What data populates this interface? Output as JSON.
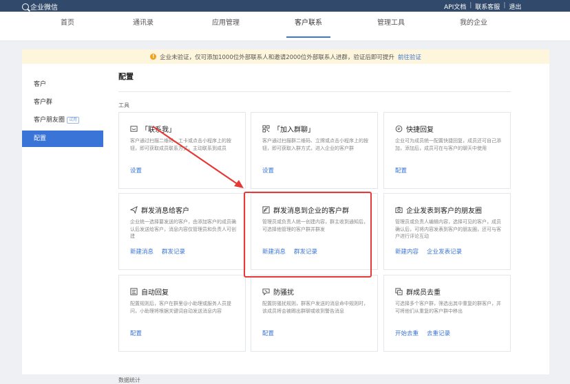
{
  "topbar": {
    "logo_text": "企业微信",
    "links": [
      "API文档",
      "联系客服",
      "退出"
    ]
  },
  "nav": {
    "items": [
      "首页",
      "通讯录",
      "应用管理",
      "客户联系",
      "管理工具",
      "我的企业"
    ],
    "active": "客户联系"
  },
  "notice": {
    "text": "企业未验证，仅可添加1000位外部联系人和邀请2000位外部联系人进群，验证后即可提升",
    "link": "前往验证"
  },
  "sidebar": {
    "items": [
      "客户",
      "客户群",
      "客户朋友圈",
      "配置"
    ],
    "beta_badge": "试用",
    "active": "配置"
  },
  "main": {
    "page_title": "配置",
    "section_tools": "工具",
    "bottom_section": "数据统计"
  },
  "cards": [
    {
      "title": "「联系我」",
      "icon": "contact-me-icon",
      "desc": "客户通过扫描二维码、工卡或点击小程序上的按钮，即可获取成员联系方式，主动联系到成员",
      "links": [
        "设置"
      ]
    },
    {
      "title": "「加入群聊」",
      "icon": "qr-code-icon",
      "desc": "客户通过扫描群二维码、立牌或点击小程序上的按钮，即可获取入群方式，进入企业的客户群",
      "links": [
        "设置"
      ]
    },
    {
      "title": "快捷回复",
      "icon": "quick-reply-icon",
      "desc": "企业可为成员统一配置快捷回复，成员还可自己添加，添加后，成员可在与客户的聊天中使用",
      "links": [
        "配置"
      ]
    },
    {
      "title": "群发消息给客户",
      "icon": "send-message-icon",
      "desc": "企业统一选择要发送的客户，由添加客户的成员确认后发送给客户，消息内容仅管理员和负责人可创建",
      "links": [
        "新建消息",
        "群发记录"
      ]
    },
    {
      "title": "群发消息到企业的客户群",
      "icon": "broadcast-icon",
      "desc": "管理员或负责人统一创建内容，群主收到通知后，可选择他管理的客户群并群发",
      "links": [
        "新建消息",
        "群发记录"
      ]
    },
    {
      "title": "企业发表到客户的朋友圈",
      "icon": "camera-icon",
      "desc": "管理员或负责人编辑内容，选择可见的客户，成员确认后，可将内容发表到客户的朋友圈，还可与客户进行评论互动",
      "links": [
        "新建内容",
        "企业发表记录"
      ]
    },
    {
      "title": "自动回复",
      "icon": "auto-reply-icon",
      "desc": "配置规则后，客户在群里@小助理或服务人员提问，小助理将根据关键词自动发送消息内容",
      "links": [
        "配置"
      ]
    },
    {
      "title": "防骚扰",
      "icon": "anti-harass-icon",
      "desc": "配置防骚扰规则，群客户发送的消息命中规则时，该成员将会被踢出群聊或收到警告消息",
      "links": [
        "配置"
      ]
    },
    {
      "title": "群成员去重",
      "icon": "dedupe-icon",
      "desc": "可选择多个客户群，筛选出其中重复的群客户，并可将他们从重复的客户群中移出",
      "links": [
        "开始去重",
        "去重记录"
      ]
    }
  ],
  "colors": {
    "topbar": "#314a6b",
    "accent": "#3a74d6",
    "highlight": "#e53935"
  }
}
